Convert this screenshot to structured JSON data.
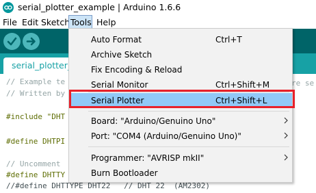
{
  "window": {
    "title": "serial_plotter_example | Arduino 1.6.6",
    "logo_icon": "arduino-logo-icon"
  },
  "menubar": {
    "items": [
      "File",
      "Edit",
      "Sketch",
      "Tools",
      "Help"
    ],
    "active": "Tools"
  },
  "toolbar": {
    "buttons": [
      "verify-icon",
      "upload-icon"
    ],
    "accent": "#006468",
    "tab_color": "#17a1a5"
  },
  "tab": {
    "label": "serial_plotter_"
  },
  "editor": {
    "lines": [
      "// Example te",
      "// Written by",
      "",
      "#include \"DHT",
      "",
      "#define DHTPI",
      "",
      "// Uncomment ",
      "#define DHTTY",
      "//#define DHTTYPE DHT22   // DHT 22  (AM2302)"
    ],
    "overflow_text": "re se"
  },
  "tools_menu": {
    "items": [
      {
        "label": "Auto Format",
        "shortcut": "Ctrl+T"
      },
      {
        "label": "Archive Sketch",
        "shortcut": ""
      },
      {
        "label": "Fix Encoding & Reload",
        "shortcut": ""
      },
      {
        "label": "Serial Monitor",
        "shortcut": "Ctrl+Shift+M"
      },
      {
        "label": "Serial Plotter",
        "shortcut": "Ctrl+Shift+L",
        "highlighted": true
      },
      {
        "label": "Board: \"Arduino/Genuino Uno\"",
        "submenu": true
      },
      {
        "label": "Port: \"COM4 (Arduino/Genuino Uno)\"",
        "submenu": true
      },
      {
        "label": "Programmer: \"AVRISP mkII\"",
        "submenu": true
      },
      {
        "label": "Burn Bootloader",
        "shortcut": ""
      }
    ],
    "highlight_color": "#91c9f7",
    "annotation_color": "#e8202a"
  }
}
